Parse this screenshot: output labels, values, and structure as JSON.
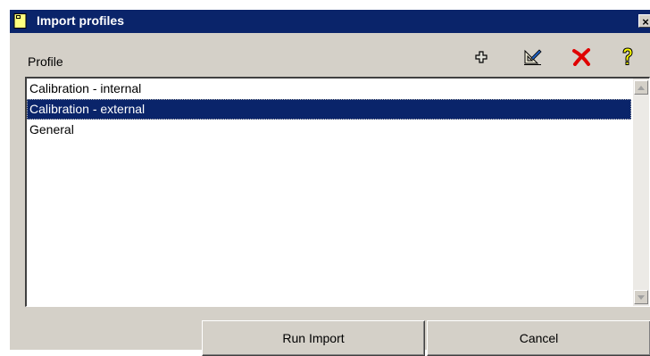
{
  "window": {
    "title": "Import profiles",
    "close_glyph": "×",
    "icon": "document-icon"
  },
  "profile_label": "Profile",
  "toolbar": {
    "add_icon": "plus-icon",
    "edit_icon": "edit-icon",
    "delete_icon": "delete-icon",
    "help_icon": "help-icon"
  },
  "profiles": [
    {
      "label": "Calibration - internal",
      "selected": false
    },
    {
      "label": "Calibration - external",
      "selected": true
    },
    {
      "label": "General",
      "selected": false
    }
  ],
  "buttons": {
    "run_import": "Run Import",
    "cancel": "Cancel"
  },
  "colors": {
    "titlebar": "#0a246a",
    "selection": "#0a246a",
    "dialog_bg": "#d4d0c8",
    "delete_icon": "#e00000",
    "help_icon": "#ffff00"
  }
}
